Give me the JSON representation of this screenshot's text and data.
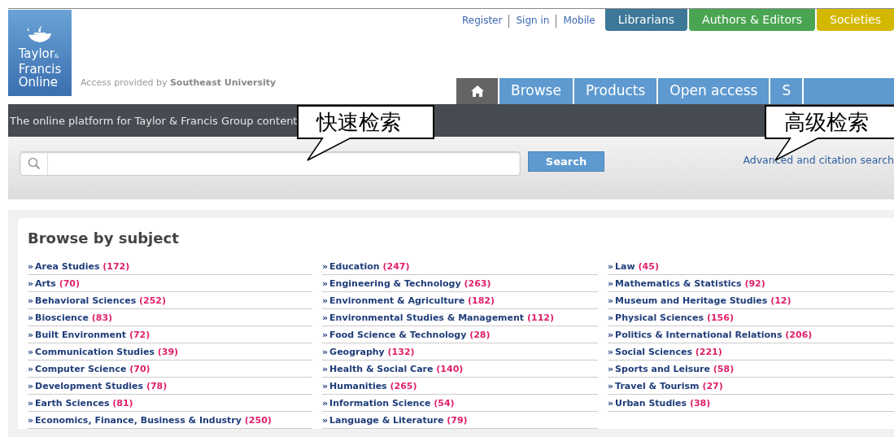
{
  "logo": {
    "lines": [
      "Taylor",
      "Francis",
      "Online"
    ],
    "ampersand": "&"
  },
  "access": {
    "prefix": "Access provided by",
    "institution": "Southeast University"
  },
  "top_links": [
    "Register",
    "Sign in",
    "Mobile"
  ],
  "audience_tabs": [
    {
      "label": "Librarians",
      "color": "#3d7898"
    },
    {
      "label": "Authors & Editors",
      "color": "#4aa552"
    },
    {
      "label": "Societies",
      "color": "#d4b800"
    }
  ],
  "nav_tabs": [
    {
      "label": "Browse"
    },
    {
      "label": "Products"
    },
    {
      "label": "Open access"
    },
    {
      "label": "S"
    }
  ],
  "tagline": "The online platform for Taylor & Francis Group content",
  "search": {
    "button": "Search",
    "advanced_link": "Advanced and citation search"
  },
  "callouts": [
    {
      "text": "快速检索",
      "kind": "quick"
    },
    {
      "text": "高级检索",
      "kind": "advanced"
    }
  ],
  "browse": {
    "title": "Browse by subject",
    "bullet": "»",
    "columns": [
      [
        {
          "name": "Area Studies",
          "count": "(172)"
        },
        {
          "name": "Arts",
          "count": "(70)"
        },
        {
          "name": "Behavioral Sciences",
          "count": "(252)"
        },
        {
          "name": "Bioscience",
          "count": "(83)"
        },
        {
          "name": "Built Environment",
          "count": "(72)"
        },
        {
          "name": "Communication Studies",
          "count": "(39)"
        },
        {
          "name": "Computer Science",
          "count": "(70)"
        },
        {
          "name": "Development Studies",
          "count": "(78)"
        },
        {
          "name": "Earth Sciences",
          "count": "(81)"
        },
        {
          "name": "Economics, Finance, Business & Industry",
          "count": "(250)"
        }
      ],
      [
        {
          "name": "Education",
          "count": "(247)"
        },
        {
          "name": "Engineering & Technology",
          "count": "(263)"
        },
        {
          "name": "Environment & Agriculture",
          "count": "(182)"
        },
        {
          "name": "Environmental Studies & Management",
          "count": "(112)"
        },
        {
          "name": "Food Science & Technology",
          "count": "(28)"
        },
        {
          "name": "Geography",
          "count": "(132)"
        },
        {
          "name": "Health & Social Care",
          "count": "(140)"
        },
        {
          "name": "Humanities",
          "count": "(265)"
        },
        {
          "name": "Information Science",
          "count": "(54)"
        },
        {
          "name": "Language & Literature",
          "count": "(79)"
        }
      ],
      [
        {
          "name": "Law",
          "count": "(45)"
        },
        {
          "name": "Mathematics & Statistics",
          "count": "(92)"
        },
        {
          "name": "Museum and Heritage Studies",
          "count": "(12)"
        },
        {
          "name": "Physical Sciences",
          "count": "(156)"
        },
        {
          "name": "Politics & International Relations",
          "count": "(206)"
        },
        {
          "name": "Social Sciences",
          "count": "(221)"
        },
        {
          "name": "Sports and Leisure",
          "count": "(58)"
        },
        {
          "name": "Travel & Tourism",
          "count": "(27)"
        },
        {
          "name": "Urban Studies",
          "count": "(38)"
        }
      ]
    ]
  }
}
